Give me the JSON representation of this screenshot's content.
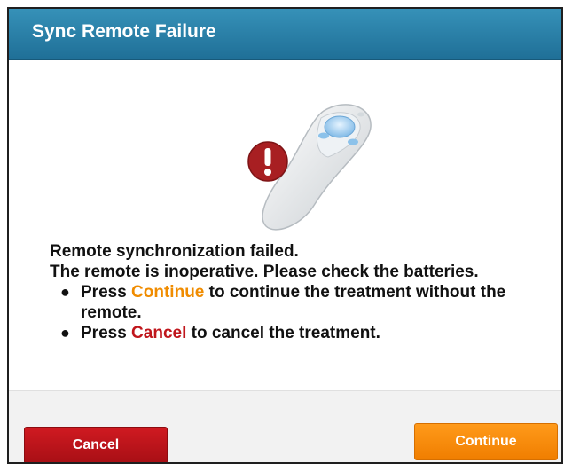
{
  "dialog": {
    "title": "Sync Remote Failure"
  },
  "illustration": {
    "remote_icon": "remote-control-icon",
    "alert_icon": "exclamation-alert-icon",
    "alert_color": "#a81f22"
  },
  "message": {
    "line1": "Remote synchronization failed.",
    "line2": "The remote is inoperative. Please check the batteries.",
    "bullets": [
      {
        "prefix": "Press ",
        "keyword": "Continue",
        "suffix": " to continue the treatment without the remote."
      },
      {
        "prefix": "Press ",
        "keyword": "Cancel",
        "suffix": " to cancel the treatment."
      }
    ]
  },
  "buttons": {
    "cancel_label": "Cancel",
    "continue_label": "Continue"
  },
  "colors": {
    "title_bar": "#2a82ab",
    "cancel": "#c0161c",
    "continue": "#f5870a"
  }
}
